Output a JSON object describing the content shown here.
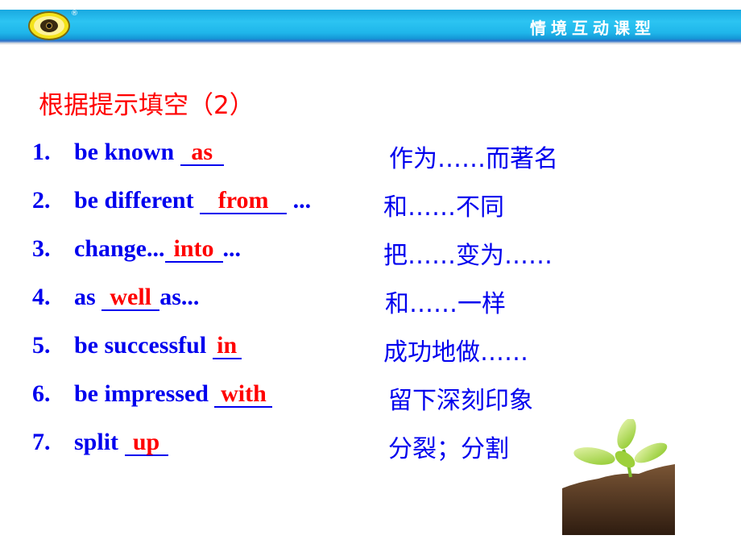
{
  "header": {
    "title": "情境互动课型",
    "logo_registered_mark": "®",
    "logo": "eye-logo"
  },
  "section_title": "根据提示填空（2）",
  "items": [
    {
      "num": "1.",
      "before": "be known ",
      "answer": "as",
      "after": "",
      "translation": "作为……而著名"
    },
    {
      "num": "2.",
      "before": "be different ",
      "answer": "from",
      "after": " ...",
      "translation": "和……不同"
    },
    {
      "num": "3.",
      "before": "change...",
      "answer": "into",
      "after": "...",
      "translation": "把……变为……"
    },
    {
      "num": "4.",
      "before": "as ",
      "answer": "well",
      "after": "as...",
      "translation": "和……一样"
    },
    {
      "num": "5.",
      "before": "be successful ",
      "answer": "in",
      "after": "",
      "translation": "成功地做……"
    },
    {
      "num": "6.",
      "before": "be impressed ",
      "answer": "with",
      "after": "",
      "translation": "留下深刻印象"
    },
    {
      "num": "7.",
      "before": "split ",
      "answer": "up",
      "after": "",
      "translation": "分裂；分割"
    }
  ],
  "image": "seedling-in-soil",
  "colors": {
    "header": "#1fb6ea",
    "title": "#ff0000",
    "text": "#0000ee",
    "answer": "#ff0000"
  }
}
